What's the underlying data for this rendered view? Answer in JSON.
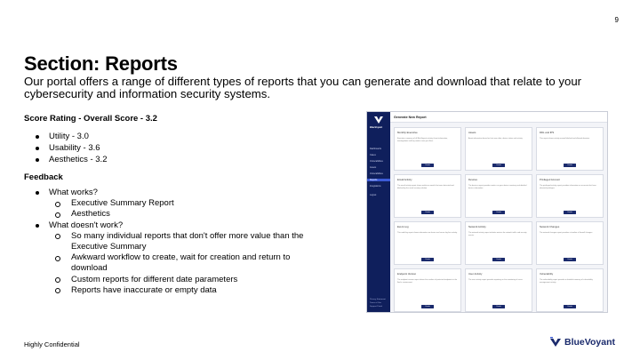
{
  "page_number": "9",
  "title": "Section: Reports",
  "intro": "Our portal offers a range of different types of reports that you can generate and download that relate to your cybersecurity and information security systems.",
  "score": {
    "heading": "Score Rating - Overall Score - 3.2",
    "items": [
      "Utility - 3.0",
      "Usability - 3.6",
      "Aesthetics - 3.2"
    ]
  },
  "feedback": {
    "heading": "Feedback",
    "works_label": "What works?",
    "works": [
      "Executive Summary Report",
      "Aesthetics"
    ],
    "doesnt_label": "What doesn't work?",
    "doesnt": [
      "So many individual reports that don't offer more value than the Executive Summary",
      "Awkward workflow to create, wait for creation and return to download",
      "Custom reports for different date parameters",
      "Reports have inaccurate or empty data"
    ]
  },
  "footer": {
    "confidential": "Highly Confidential",
    "brand": "BlueVoyant"
  },
  "colors": {
    "brand_navy": "#1a2a6c",
    "sidebar_navy": "#0f1f5c",
    "sidebar_active": "#3c5bd6"
  },
  "mockup": {
    "logo_text": "BlueVoyant",
    "header_title": "Generate New Report",
    "sidebar_items": [
      "Dashboards",
      "Cases",
      "Vulnerabilities",
      "Assets",
      "Vulnerabilities",
      "Reports",
      "Integrations",
      "Logout"
    ],
    "active_item": "Reports",
    "sidebar_footer": [
      "Privacy Statement",
      "Terms of Use",
      "Support Portal"
    ],
    "button_label": "Create",
    "cards": [
      {
        "title": "Monthly Executive",
        "desc": "Executive summary of all BlueVoyant activity, threat information, investigations and key metrics over your fleet."
      },
      {
        "title": "Assets",
        "desc": "Asset information based on last seen date, device status and activity."
      },
      {
        "title": "DDL and IPS",
        "desc": "This report shows activity around blocked and allowed domains."
      },
      {
        "title": "Email Activity",
        "desc": "The email activity report shows malicious emails that were detected and blocked by the email security solution."
      },
      {
        "title": "Devices",
        "desc": "The devices report provides metrics on your device inventory and detailed device information."
      },
      {
        "title": "Privileged Account",
        "desc": "The privileged activity report provides information on accounts that have elevated privileges."
      },
      {
        "title": "Event Log",
        "desc": "This audit log report shows information on device and server log line activity."
      },
      {
        "title": "Network Activity",
        "desc": "The network activity report includes metrics for network traffic and security events."
      },
      {
        "title": "Network Changes",
        "desc": "The network changes report provides a timeline of firewall changes."
      },
      {
        "title": "Endpoint Version",
        "desc": "The endpoint version report shows the number of protected endpoints in the fleet's environment."
      },
      {
        "title": "User Activity",
        "desc": "The user activity report provides reporting on the monitoring of users."
      },
      {
        "title": "Vulnerability",
        "desc": "The vulnerability report provides a detailed summary of vulnerability management activity."
      }
    ]
  }
}
